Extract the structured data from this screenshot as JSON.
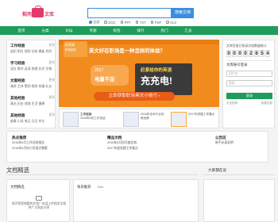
{
  "header": {
    "brand": "稻壳",
    "site_title": "文库",
    "search_placeholder": "",
    "search_button": "搜索文档",
    "filters": [
      {
        "label": "全部",
        "active": true
      },
      {
        "label": "DOC",
        "active": false
      },
      {
        "label": "PPT",
        "active": false
      },
      {
        "label": "TXT",
        "active": false
      },
      {
        "label": "PDF",
        "active": false
      },
      {
        "label": "XLS",
        "active": false
      }
    ]
  },
  "nav": {
    "items": [
      "首页",
      "分类",
      "论坛",
      "专题",
      "标签",
      "排行",
      "热门",
      "汇总"
    ]
  },
  "sidebar": {
    "categories": [
      {
        "title": "工作经验",
        "more": "更多",
        "links": "组织 职位 规划 总结 模板 合同"
      },
      {
        "title": "学习经验",
        "more": "更多",
        "links": "语文 数学 英语 物理 化学 生物"
      },
      {
        "title": "文案经验",
        "more": "更多",
        "links": "演讲 主持 策划 致辞 祝福 礼仪"
      },
      {
        "title": "其他经验",
        "more": "更多",
        "links": "政治 历史 地理 生活 健康"
      },
      {
        "title": "其他经验",
        "more": "更多",
        "links": "故事 小说 笔记 日记 作文"
      }
    ]
  },
  "banner": {
    "card_title": "稻壳网",
    "card_sub": "职场英语",
    "headline": "英文好在职场是一种怎样的体验？",
    "year": "2017",
    "battery_text": "电量不足",
    "accent_line": "赶紧给你的英语",
    "big_text": "充充电!",
    "cta": "立即获取职场英文小技巧 ›",
    "accent_color": "#f28b1e"
  },
  "thumbs": [
    {
      "title": "工作经验",
      "sub": "2016年6月工作总结"
    },
    {
      "title": "2016年全年行业轮换优势",
      "sub": ""
    },
    {
      "title": "2017年党建工作要点",
      "sub": ""
    }
  ],
  "rpanel": {
    "label": "文库目前已收录文档数量统计",
    "counter": [
      "0",
      "0",
      "0",
      "0",
      "2",
      "6",
      "5",
      "4"
    ],
    "login_title": "文库账号登录",
    "user_placeholder": "用户名",
    "pass_placeholder": "密码",
    "login_button": "登录",
    "forgot": "忘记密码",
    "register": "免费注册"
  },
  "mid": {
    "col1_title": "热点推荐",
    "col1_items": [
      "2016年6月工作总结报告",
      "2016年6月份小学语文教案"
    ],
    "col2_title": "精品文档",
    "col2_items": [
      "2016年6月份月度总结",
      "2017年度党建工作要点"
    ],
    "col3_title": "公告区",
    "col3_items": [
      "新手必读说明"
    ]
  },
  "sections": {
    "title": "文档精选",
    "right_title": "大家都在读"
  },
  "boxes": {
    "box1_title": "文档精选",
    "box1_note": "找不到您想要的文档？欢迎上传相关文档供广大网友分享",
    "box2_title": "每日推荐",
    "box2_sub": "Doc",
    "box3_title": ""
  }
}
